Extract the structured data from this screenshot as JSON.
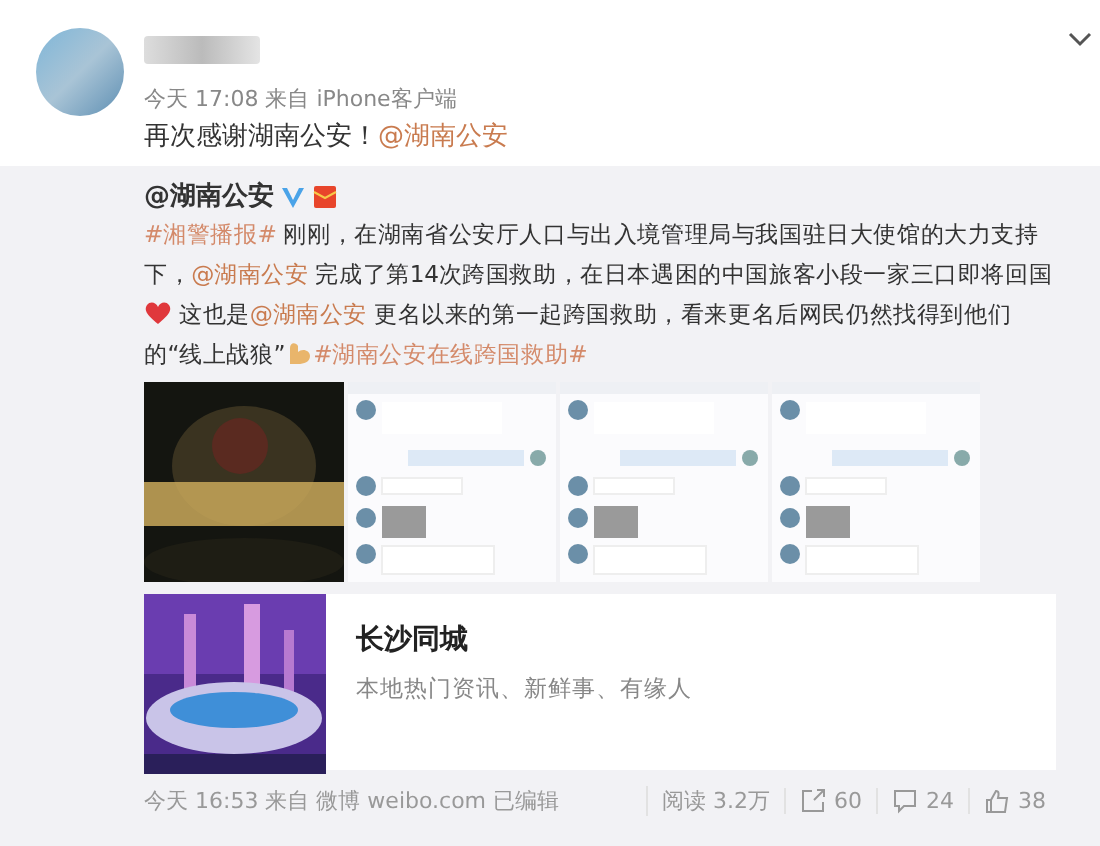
{
  "post": {
    "meta": "今天 17:08 来自 iPhone客户端",
    "text": "再次感谢湖南公安！",
    "mention": "@湖南公安"
  },
  "repost": {
    "author": "@湖南公安",
    "body": [
      {
        "kind": "topic",
        "text": "#湘警播报#"
      },
      {
        "kind": "plain",
        "text": " 刚刚，在湖南省公安厅人口与出入境管理局与我国驻日大使馆的大力支持下，"
      },
      {
        "kind": "link",
        "text": "@湖南公安"
      },
      {
        "kind": "plain",
        "text": " 完成了第14次跨国救助，在日本遇困的中国旅客小段一家三口即将回国"
      },
      {
        "kind": "heart"
      },
      {
        "kind": "plain",
        "text": " 这也是"
      },
      {
        "kind": "link",
        "text": "@湖南公安"
      },
      {
        "kind": "plain",
        "text": " 更名以来的第一起跨国救助，看来更名后网民仍然找得到他们的“线上战狼”"
      },
      {
        "kind": "arm"
      },
      {
        "kind": "topic",
        "text": "#湖南公安在线跨国救助#"
      }
    ],
    "images": [
      {
        "kind": "picture"
      },
      {
        "kind": "chat"
      },
      {
        "kind": "chat"
      },
      {
        "kind": "chat"
      }
    ],
    "card": {
      "title": "长沙同城",
      "subtitle": "本地热门资讯、新鲜事、有缘人"
    },
    "meta": "今天 16:53 来自 微博 weibo.com  已编辑",
    "reads": "阅读 3.2万",
    "reposts": "60",
    "comments": "24",
    "likes": "38"
  }
}
